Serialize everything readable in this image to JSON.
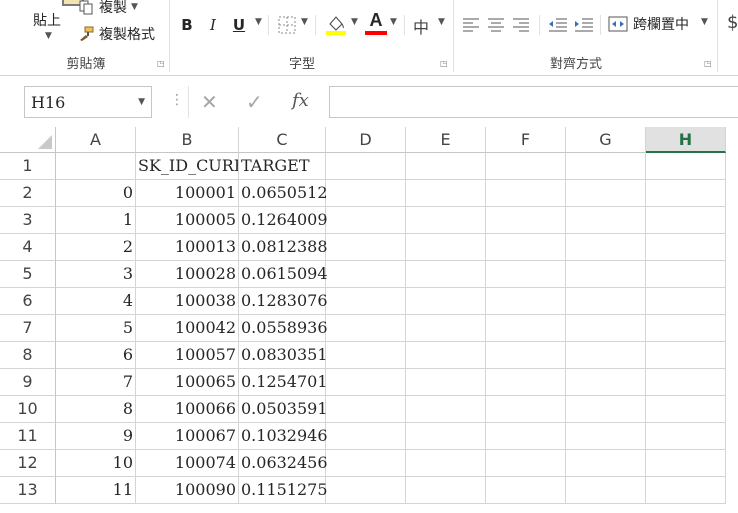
{
  "ribbon": {
    "clipboard": {
      "paste_label": "貼上",
      "copy_label": "複製",
      "format_painter_label": "複製格式",
      "group_label": "剪貼簿"
    },
    "font": {
      "bold": "B",
      "italic": "I",
      "underline": "U",
      "font_color_glyph": "A",
      "group_label": "字型"
    },
    "alignment": {
      "merge_center_label": "跨欄置中",
      "group_label": "對齊方式"
    },
    "number": {
      "currency_glyph": "$"
    },
    "colors": {
      "highlight": "#ffff00",
      "font_color": "#ff0000",
      "accent": "#217346"
    }
  },
  "formula_bar": {
    "name_box": "H16",
    "fx_glyph": "fx",
    "cancel_glyph": "✕",
    "enter_glyph": "✓",
    "value": ""
  },
  "sheet": {
    "columns": [
      "A",
      "B",
      "C",
      "D",
      "E",
      "F",
      "G",
      "H"
    ],
    "active_column": "H",
    "row_numbers": [
      "1",
      "2",
      "3",
      "4",
      "5",
      "6",
      "7",
      "8",
      "9",
      "10",
      "11",
      "12",
      "13"
    ],
    "header_row": {
      "A": "",
      "B": "SK_ID_CURR",
      "C": "TARGET"
    },
    "rows": [
      {
        "A": "0",
        "B": "100001",
        "C": "0.0650512"
      },
      {
        "A": "1",
        "B": "100005",
        "C": "0.1264009"
      },
      {
        "A": "2",
        "B": "100013",
        "C": "0.0812388"
      },
      {
        "A": "3",
        "B": "100028",
        "C": "0.0615094"
      },
      {
        "A": "4",
        "B": "100038",
        "C": "0.1283076"
      },
      {
        "A": "5",
        "B": "100042",
        "C": "0.0558936"
      },
      {
        "A": "6",
        "B": "100057",
        "C": "0.0830351"
      },
      {
        "A": "7",
        "B": "100065",
        "C": "0.1254701"
      },
      {
        "A": "8",
        "B": "100066",
        "C": "0.0503591"
      },
      {
        "A": "9",
        "B": "100067",
        "C": "0.1032946"
      },
      {
        "A": "10",
        "B": "100074",
        "C": "0.0632456"
      },
      {
        "A": "11",
        "B": "100090",
        "C": "0.1151275"
      }
    ]
  }
}
